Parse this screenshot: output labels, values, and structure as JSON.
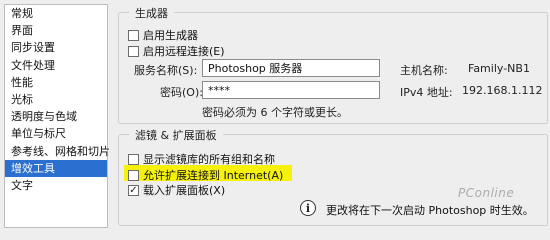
{
  "sidebar": {
    "items": [
      {
        "label": "常规"
      },
      {
        "label": "界面"
      },
      {
        "label": "同步设置"
      },
      {
        "label": "文件处理"
      },
      {
        "label": "性能"
      },
      {
        "label": "光标"
      },
      {
        "label": "透明度与色域"
      },
      {
        "label": "单位与标尺"
      },
      {
        "label": "参考线、网格和切片"
      },
      {
        "label": "增效工具"
      },
      {
        "label": "文字"
      }
    ],
    "selected_index": 9
  },
  "generator": {
    "title": "生成器",
    "enable_label": "启用生成器",
    "remote_label": "启用远程连接(E)",
    "service_name_label": "服务名称(S):",
    "service_name_value": "Photoshop 服务器",
    "password_label": "密码(O):",
    "password_value": "****",
    "password_hint": "密码必须为 6 个字符或更长。",
    "host_label": "主机名称:",
    "host_value": "Family-NB1",
    "ip_label": "IPv4 地址:",
    "ip_value": "192.168.1.112"
  },
  "filters": {
    "title": "滤镜 & 扩展面板",
    "show_all_label": "显示滤镜库的所有组和名称",
    "allow_internet_label": "允许扩展连接到 Internet(A)",
    "load_panels_label": "载入扩展面板(X)",
    "load_panels_checked": true
  },
  "info": {
    "message": "更改将在下一次启动 Photoshop 时生效。"
  },
  "watermark": "PConline",
  "colors": {
    "selection": "#2b6fd1",
    "highlight": "#f6f00a"
  }
}
